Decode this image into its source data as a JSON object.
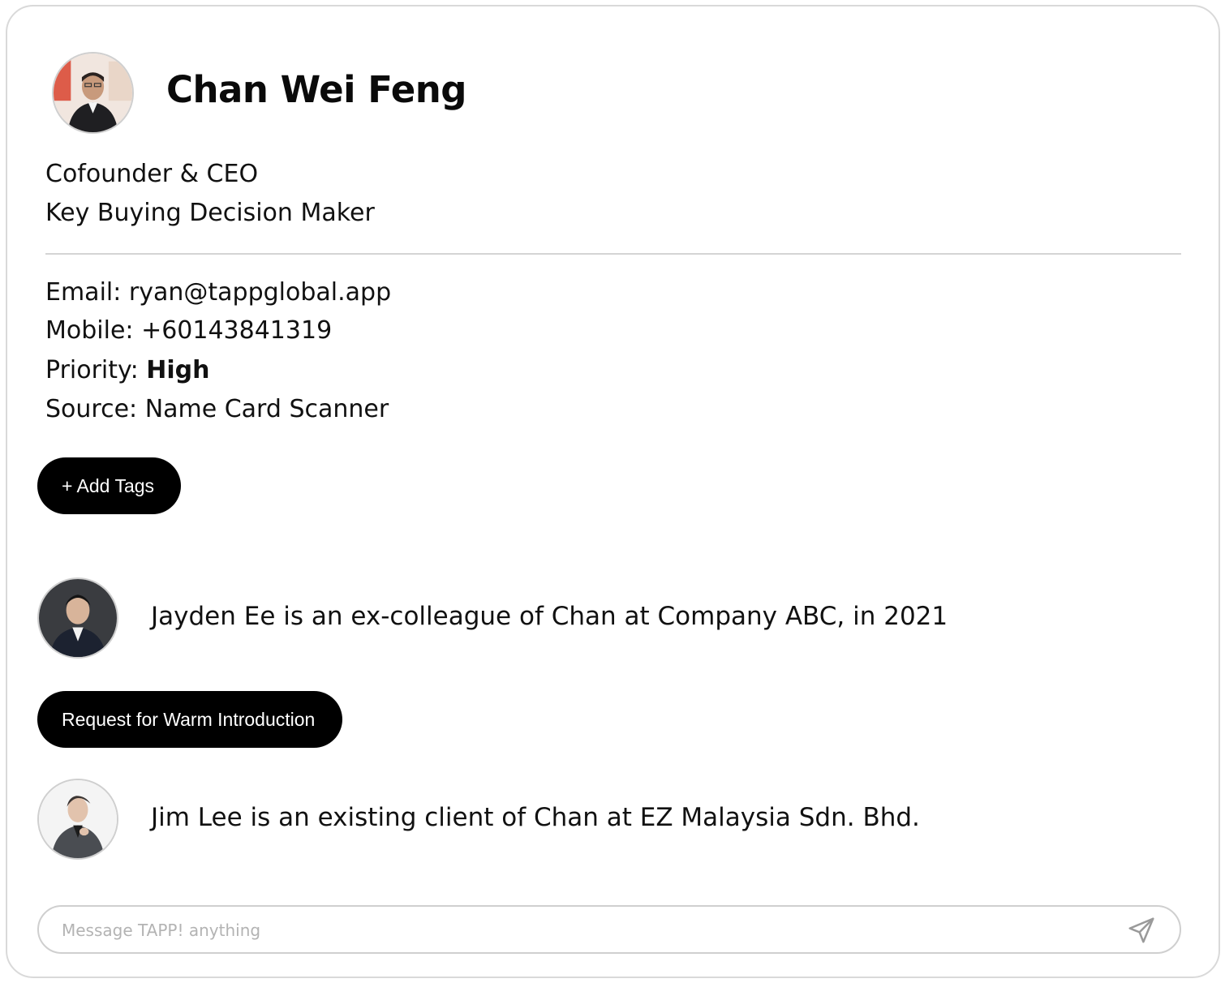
{
  "profile": {
    "name": "Chan Wei Feng",
    "role": "Cofounder & CEO",
    "tag": "Key Buying Decision Maker",
    "avatar_icon": "person-photo-avatar"
  },
  "contact": {
    "email_label": "Email: ",
    "email_value": "ryan@tappglobal.app",
    "mobile_label": "Mobile: ",
    "mobile_value": "+60143841319",
    "priority_label": "Priority: ",
    "priority_value": "High",
    "source_label": "Source: ",
    "source_value": "Name Card Scanner"
  },
  "actions": {
    "add_tags_label": "+ Add Tags",
    "warm_intro_label": "Request for Warm Introduction"
  },
  "connections": [
    {
      "text": "Jayden Ee is an ex-colleague of Chan at Company ABC, in 2021",
      "avatar_icon": "person-photo-avatar"
    },
    {
      "text": "Jim Lee is an existing client of Chan at EZ Malaysia Sdn. Bhd.",
      "avatar_icon": "person-photo-avatar"
    }
  ],
  "chat": {
    "placeholder": "Message TAPP! anything",
    "value": "",
    "send_icon": "send-icon"
  },
  "colors": {
    "button_bg": "#000000",
    "button_text": "#ffffff",
    "border": "#d9d9d9",
    "text": "#111111"
  }
}
